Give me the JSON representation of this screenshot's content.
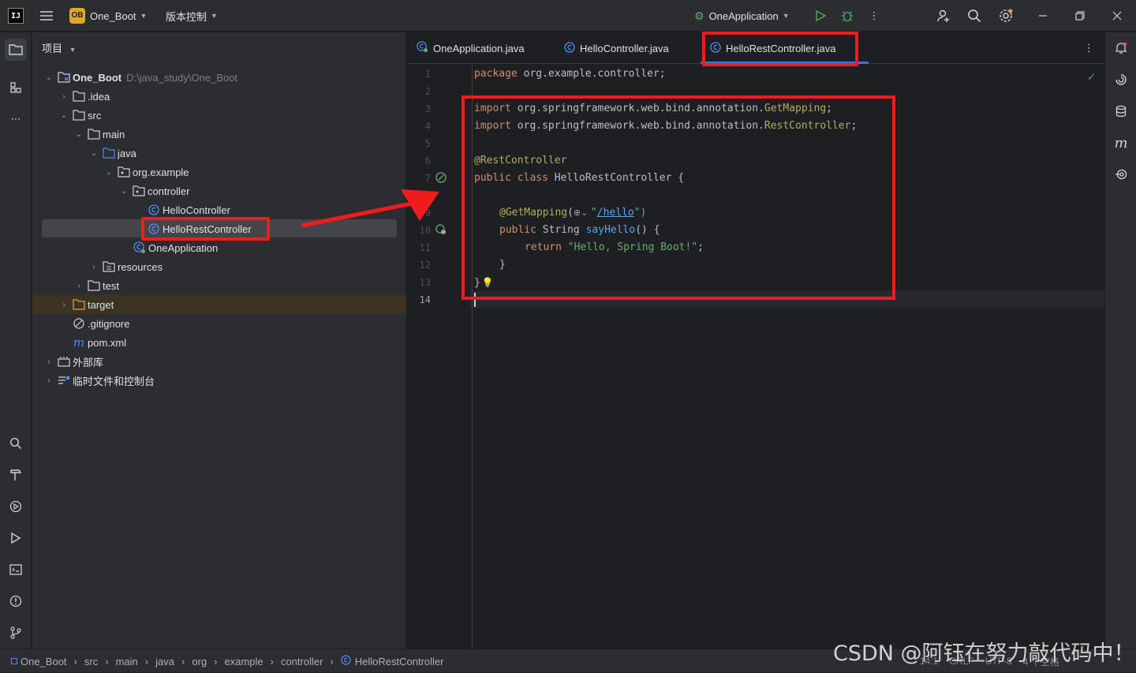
{
  "titlebar": {
    "logo": "IJ",
    "project_badge": "OB",
    "project_name": "One_Boot",
    "vcs_label": "版本控制",
    "run_config": "OneApplication"
  },
  "project_panel": {
    "title": "项目",
    "tree": [
      {
        "label": "One_Boot",
        "hint": "D:\\java_study\\One_Boot",
        "icon": "module-folder-icon",
        "expanded": true
      },
      {
        "label": ".idea",
        "icon": "folder-icon",
        "expanded": false
      },
      {
        "label": "src",
        "icon": "folder-icon",
        "expanded": true
      },
      {
        "label": "main",
        "icon": "folder-icon",
        "expanded": true
      },
      {
        "label": "java",
        "icon": "source-folder-icon",
        "expanded": true
      },
      {
        "label": "org.example",
        "icon": "package-icon",
        "expanded": true
      },
      {
        "label": "controller",
        "icon": "package-icon",
        "expanded": true
      },
      {
        "label": "HelloController",
        "icon": "class-icon"
      },
      {
        "label": "HelloRestController",
        "icon": "class-icon"
      },
      {
        "label": "OneApplication",
        "icon": "spring-class-icon"
      },
      {
        "label": "resources",
        "icon": "resources-folder-icon",
        "expanded": false
      },
      {
        "label": "test",
        "icon": "folder-icon",
        "expanded": false
      },
      {
        "label": "target",
        "icon": "excluded-folder-icon",
        "expanded": false
      },
      {
        "label": ".gitignore",
        "icon": "ignore-file-icon"
      },
      {
        "label": "pom.xml",
        "icon": "maven-icon"
      },
      {
        "label": "外部库",
        "icon": "library-icon",
        "expanded": false
      },
      {
        "label": "临时文件和控制台",
        "icon": "scratch-icon",
        "expanded": false
      }
    ]
  },
  "editor": {
    "tabs": [
      {
        "label": "OneApplication.java"
      },
      {
        "label": "HelloController.java"
      },
      {
        "label": "HelloRestController.java"
      }
    ],
    "line_numbers": [
      "1",
      "2",
      "3",
      "4",
      "5",
      "6",
      "7",
      "8",
      "9",
      "10",
      "11",
      "12",
      "13",
      "14"
    ],
    "code": {
      "l1_kw": "package",
      "l1_rest": " org.example.controller;",
      "l3_kw": "import",
      "l3_rest": " org.springframework.web.bind.annotation.",
      "l3_ann": "GetMapping",
      "l3_end": ";",
      "l4_kw": "import",
      "l4_rest": " org.springframework.web.bind.annotation.",
      "l4_ann": "RestController",
      "l4_end": ";",
      "l6_ann": "@RestController",
      "l7_kw": "public class",
      "l7_rest": " HelloRestController {",
      "l9_ann": "@GetMapping",
      "l9_open": "(",
      "l9_q": "\"",
      "l9_path": "/hello",
      "l9_close": "\")",
      "l10_kw": "public",
      "l10_type": " String ",
      "l10_fn": "sayHello",
      "l10_rest": "() {",
      "l11_kw": "return",
      "l11_str": " \"Hello, Spring Boot!\"",
      "l11_end": ";",
      "l12": "}",
      "l13": "}"
    }
  },
  "breadcrumb": [
    "One_Boot",
    "src",
    "main",
    "java",
    "org",
    "example",
    "controller",
    "HelloRestController"
  ],
  "status_right": [
    "14:1",
    "CRLF",
    "UTF-8",
    "4 个空格"
  ],
  "watermark": "CSDN @阿钰在努力敲代码中！",
  "colors": {
    "accent": "#3574f0",
    "highlight_box": "#f01c1c",
    "keyword": "#cf8e6d",
    "annotation": "#b3ae60",
    "string": "#6aab73",
    "function": "#56a8f5"
  }
}
